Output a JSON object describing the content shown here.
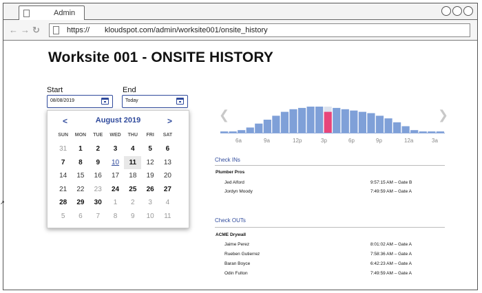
{
  "browser": {
    "tab_label": "Admin",
    "url_scheme": "https://",
    "url_path": "kloudspot.com/admin/worksite001/onsite_history"
  },
  "page": {
    "title": "Worksite 001 - ONSITE HISTORY"
  },
  "date_range": {
    "start_label": "Start",
    "start_value": "08/08/2019",
    "end_label": "End",
    "end_value": "Today"
  },
  "calendar": {
    "prev": "<",
    "next": ">",
    "month": "August 2019",
    "weekdays": [
      "SUN",
      "MON",
      "TUE",
      "WED",
      "THU",
      "FRI",
      "SAT"
    ],
    "weeks": [
      [
        "31",
        "1",
        "2",
        "3",
        "4",
        "5",
        "6"
      ],
      [
        "7",
        "8",
        "9",
        "10",
        "11",
        "12",
        "13"
      ],
      [
        "14",
        "15",
        "16",
        "17",
        "18",
        "19",
        "20"
      ],
      [
        "21",
        "22",
        "23",
        "24",
        "25",
        "26",
        "27"
      ],
      [
        "28",
        "29",
        "30",
        "1",
        "2",
        "3",
        "4"
      ],
      [
        "5",
        "6",
        "7",
        "8",
        "9",
        "10",
        "11"
      ]
    ]
  },
  "chart_data": {
    "type": "bar",
    "x_tick_labels": [
      "6a",
      "9a",
      "12p",
      "3p",
      "6p",
      "9p",
      "12a",
      "3a"
    ],
    "values": [
      1,
      1,
      2,
      4,
      7,
      10,
      13,
      16,
      18,
      19,
      20,
      20,
      20,
      19,
      18,
      17,
      16,
      15,
      13,
      11,
      8,
      5,
      2,
      1,
      1,
      1
    ],
    "highlight_index": 12,
    "highlight_value": 16,
    "colors": {
      "bar": "#7fa0d8",
      "highlight": "#e8457a",
      "ghost": "#dde3ee"
    }
  },
  "checkins": {
    "title": "Check INs",
    "company": "Plumber Pros",
    "entries": [
      {
        "name": "Jed Alford",
        "time": "9:57:15 AM – Gate B"
      },
      {
        "name": "Jordyn Moody",
        "time": "7:49:59 AM – Gate A"
      }
    ]
  },
  "checkouts": {
    "title": "Check OUTs",
    "company": "ACME Drywall",
    "entries": [
      {
        "name": "Jaime Perez",
        "time": "8:01:02 AM – Gate A"
      },
      {
        "name": "Rueben Gutierrez",
        "time": "7:58:36 AM – Gate A"
      },
      {
        "name": "Baran Boyce",
        "time": "6:42:23 AM – Gate A"
      },
      {
        "name": "Odin Fulton",
        "time": "7:49:59 AM – Gate A"
      }
    ]
  }
}
